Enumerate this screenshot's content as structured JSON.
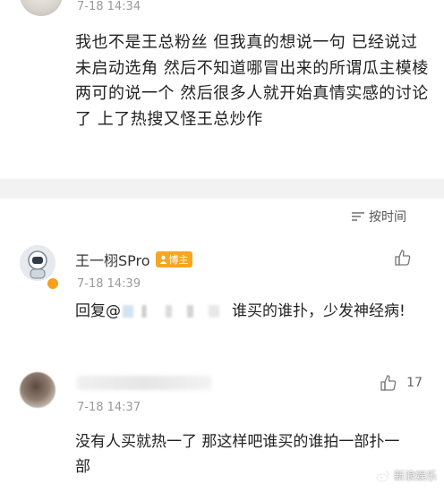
{
  "top_comment": {
    "time": "7-18 14:34",
    "text": "我也不是王总粉丝 但我真的想说一句 已经说过未启动选角 然后不知道哪冒出来的所谓瓜主模棱两可的说一个 然后很多人就开始真情实感的讨论了 上了热搜又怪王总炒作"
  },
  "sort_bar": {
    "label": "按时间",
    "icon": "sort-lines-icon"
  },
  "comments": [
    {
      "username": "王一栩SPro",
      "badge": "博主",
      "time": "7-18 14:39",
      "reply_prefix": "回复@",
      "reply_suffix": "谁买的谁扑，少发神经病!",
      "likes": ""
    },
    {
      "time": "7-18 14:37",
      "text": "没有人买就热一了 那这样吧谁买的谁拍一部扑一部",
      "likes": "17"
    }
  ],
  "watermark": "新浪娱乐",
  "colors": {
    "divider": "#f2f2f2",
    "badge": "#f5a623",
    "muted_text": "#9a9a9a"
  }
}
